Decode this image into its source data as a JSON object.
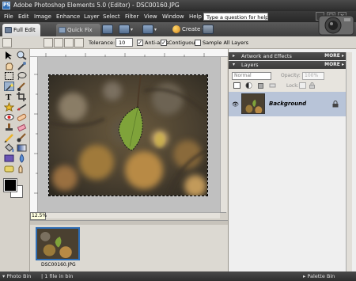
{
  "window": {
    "title": "Adobe Photoshop Elements 5.0 (Editor) - DSC00160.JPG",
    "controls": [
      "_",
      "□",
      "×"
    ]
  },
  "menu": [
    "File",
    "Edit",
    "Image",
    "Enhance",
    "Layer",
    "Select",
    "Filter",
    "View",
    "Window",
    "Help"
  ],
  "help_placeholder": "Type a question for help",
  "modes": {
    "full_edit": "Full Edit",
    "quick_fix": "Quick Fix"
  },
  "shortcuts": {
    "create_label": "Create"
  },
  "options": {
    "tolerance_label": "Tolerance:",
    "tolerance_value": "10",
    "anti_alias_label": "Anti-alias",
    "anti_alias_checked": true,
    "contiguous_label": "Contiguous",
    "contiguous_checked": true,
    "sample_all_label": "Sample All Layers",
    "sample_all_checked": false
  },
  "palettes": {
    "artwork_title": "Artwork and Effects",
    "layers_title": "Layers",
    "more_label": "MORE"
  },
  "layers": {
    "blend_mode": "Normal",
    "opacity_label": "Opacity:",
    "opacity_value": "100%",
    "lock_label": "Lock:",
    "items": [
      {
        "name": "Background",
        "visible": true,
        "locked": true
      }
    ]
  },
  "document": {
    "zoom": "12.5%"
  },
  "photo_bin": {
    "items": [
      {
        "filename": "DSC00160.JPG"
      }
    ]
  },
  "status": {
    "photo_bin": "Photo Bin",
    "file_count": "1 file in bin",
    "palette_bin": "Palette Bin"
  }
}
